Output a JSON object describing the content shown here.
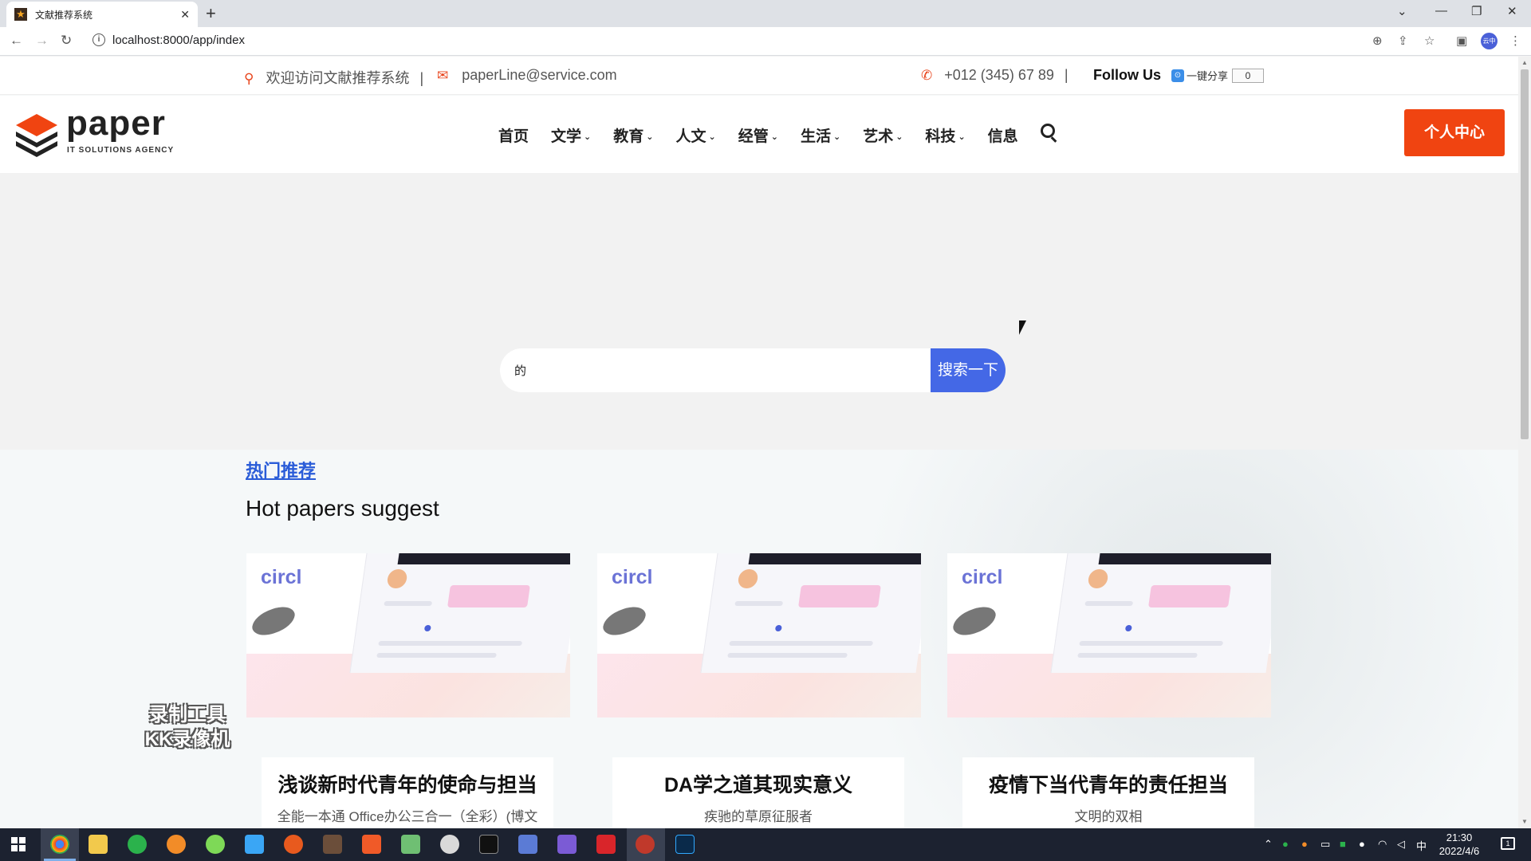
{
  "browser": {
    "tab_title": "文献推荐系统",
    "url": "localhost:8000/app/index",
    "profile_label": "云中"
  },
  "topinfo": {
    "welcome": "欢迎访问文献推荐系统",
    "separator": "|",
    "email": "paperLine@service.com",
    "phone": "+012 (345) 67 89",
    "follow": "Follow Us",
    "share_label": "一键分享",
    "share_count": "0"
  },
  "nav": {
    "logo_text": "paper",
    "logo_sub": "IT SOLUTIONS AGENCY",
    "items": [
      {
        "label": "首页",
        "has_caret": false
      },
      {
        "label": "文学",
        "has_caret": true
      },
      {
        "label": "教育",
        "has_caret": true
      },
      {
        "label": "人文",
        "has_caret": true
      },
      {
        "label": "经管",
        "has_caret": true
      },
      {
        "label": "生活",
        "has_caret": true
      },
      {
        "label": "艺术",
        "has_caret": true
      },
      {
        "label": "科技",
        "has_caret": true
      },
      {
        "label": "信息",
        "has_caret": false
      }
    ],
    "personal_center": "个人中心"
  },
  "hero": {
    "search_value": "的",
    "search_button": "搜索一下"
  },
  "recommend": {
    "link": "热门推荐",
    "heading": "Hot papers suggest",
    "cards": [
      {
        "image_brand": "circl",
        "title": "浅谈新时代青年的使命与担当",
        "subtitle": "全能一本通 Office办公三合一（全彩）(博文视点出品)"
      },
      {
        "image_brand": "circl",
        "title": "DA学之道其现实意义",
        "subtitle": "疾驰的草原征服者"
      },
      {
        "image_brand": "circl",
        "title": "疫情下当代青年的责任担当",
        "subtitle": "文明的双相"
      }
    ]
  },
  "watermark": {
    "line1": "录制工具",
    "line2": "KK录像机"
  },
  "taskbar": {
    "clock_time": "21:30",
    "clock_date": "2022/4/6",
    "ime": "中",
    "notif_count": "1"
  },
  "colors": {
    "accent_orange": "#f04411",
    "search_blue": "#4468e6",
    "link_blue": "#2a5cd8"
  }
}
